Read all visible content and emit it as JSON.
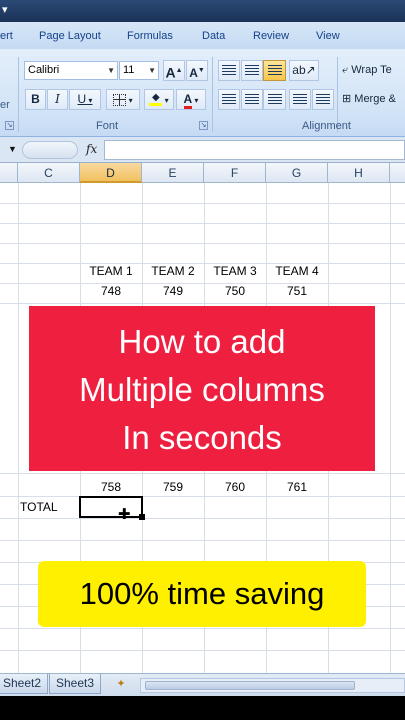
{
  "ribbon": {
    "tabs": [
      "ert",
      "Page Layout",
      "Formulas",
      "Data",
      "Review",
      "View"
    ],
    "font_name": "Calibri",
    "font_size": "11",
    "grow_font": "A",
    "shrink_font": "A",
    "bold": "B",
    "italic": "I",
    "underline": "U",
    "font_color": "A",
    "wrap_text": "Wrap Te",
    "merge": "Merge &",
    "group_font": "Font",
    "group_alignment": "Alignment",
    "highlight_color": "#ffff00",
    "font_color_bar": "#e02020"
  },
  "formula_bar": {
    "fx": "fx",
    "value": ""
  },
  "grid": {
    "columns": [
      "C",
      "D",
      "E",
      "F",
      "G",
      "H"
    ],
    "selected_column": "D",
    "team_headers": [
      "TEAM 1",
      "TEAM 2",
      "TEAM 3",
      "TEAM 4"
    ],
    "first_row": [
      "748",
      "749",
      "750",
      "751"
    ],
    "last_row": [
      "758",
      "759",
      "760",
      "761"
    ],
    "total_label": "TOTAL"
  },
  "overlay": {
    "title_lines": [
      "How to add",
      "Multiple columns",
      "In seconds"
    ],
    "badge": "100% time saving",
    "red_color": "#ee1f3f",
    "yellow_color": "#fff000"
  },
  "sheets": [
    "Sheet2",
    "Sheet3"
  ]
}
